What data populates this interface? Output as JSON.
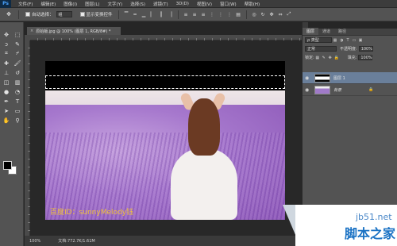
{
  "app": {
    "logo": "Ps"
  },
  "menu": [
    "文件(F)",
    "编辑(E)",
    "图像(I)",
    "图层(L)",
    "文字(Y)",
    "选择(S)",
    "滤镜(T)",
    "3D(D)",
    "视图(V)",
    "窗口(W)",
    "帮助(H)"
  ],
  "options": {
    "tool_icon": "move-tool-icon",
    "auto_select_label": "自动选择：",
    "auto_select_value": "组",
    "show_transform_label": "显示变换控件"
  },
  "document": {
    "tab_title": "原始版.jpg @ 100% (图层 1, RGB/8#) *",
    "watermark_text": "百度ID：sunnyMelody钰"
  },
  "status": {
    "zoom": "100%",
    "doc_info": "文档:772.7K/1.61M"
  },
  "panel": {
    "tabs": [
      "图层",
      "通道",
      "路径"
    ],
    "kind_label": "ρ 类型",
    "blend_mode": "正常",
    "opacity_label": "不透明度:",
    "opacity_value": "100%",
    "lock_label": "锁定:",
    "fill_label": "填充:",
    "fill_value": "100%",
    "layers": [
      {
        "name": "图层 1",
        "selected": true
      },
      {
        "name": "背景",
        "selected": false
      }
    ]
  },
  "site": {
    "url": "jb51.net",
    "name": "脚本之家"
  },
  "colors": {
    "accent": "#4aa3ff",
    "watermark": "#f0c23a",
    "selected_layer": "#6a7f9a"
  }
}
